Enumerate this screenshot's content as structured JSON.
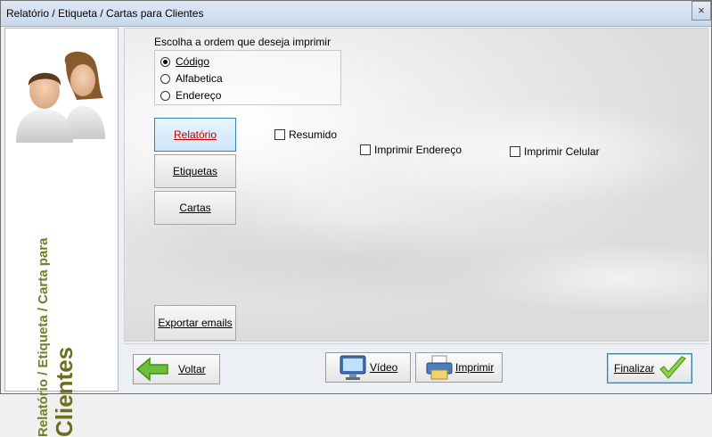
{
  "window": {
    "title": "Relatório / Etiqueta / Cartas para Clientes",
    "close_glyph": "×"
  },
  "sidebar": {
    "line1": "Relatório / Etiqueta / Carta para",
    "line2": "Clientes"
  },
  "order": {
    "label": "Escolha a ordem que deseja imprimir",
    "options": [
      {
        "label": "Código",
        "selected": true
      },
      {
        "label": "Alfabetica",
        "selected": false
      },
      {
        "label": "Endereço",
        "selected": false
      }
    ]
  },
  "side_buttons": {
    "relatorio": "Relatório",
    "etiquetas": "Etiquetas",
    "cartas": "Cartas",
    "exportar": "Exportar emails"
  },
  "options": {
    "resumido": "Resumido",
    "imprimir_endereco": "Imprimir Endereço",
    "imprimir_celular": "Imprimir Celular"
  },
  "toolbar": {
    "voltar": "Voltar",
    "video": "Vídeo",
    "imprimir": "Imprimir",
    "finalizar": "Finalizar"
  },
  "colors": {
    "accent_red": "#c00000",
    "sidebar_text": "#6a7020",
    "arrow_green": "#6dbf3a"
  },
  "icons": [
    "users-icon",
    "back-arrow-icon",
    "monitor-icon",
    "printer-icon",
    "checkmark-icon"
  ]
}
